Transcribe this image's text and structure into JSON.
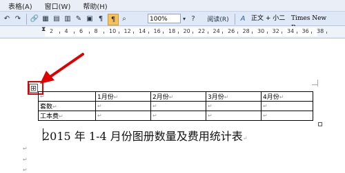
{
  "menu": [
    "表格(A)",
    "窗口(W)",
    "帮助(H)"
  ],
  "toolbar": {
    "zoom": "100%",
    "read_label": "阅读(R)",
    "style": "正文 + 小二",
    "font": "Times New Roman"
  },
  "ruler": [
    "2",
    "4",
    "6",
    "8",
    "10",
    "12",
    "14",
    "16",
    "18",
    "20",
    "22",
    "24",
    "26",
    "28",
    "30",
    "32",
    "34",
    "36",
    "38"
  ],
  "table": {
    "headers": [
      "",
      "1月份",
      "2月份",
      "3月份",
      "4月份"
    ],
    "rows": [
      [
        "套数",
        "",
        "",
        "",
        ""
      ],
      [
        "工本费",
        "",
        "",
        "",
        ""
      ]
    ]
  },
  "title": "2015 年 1-4 月份图册数量及费用统计表",
  "para_mark": "↵",
  "colors": {
    "annotation": "#e00000",
    "toolbar": "#dfe8f7"
  },
  "icons": [
    "table-move-handle-icon",
    "red-arrow-icon"
  ]
}
